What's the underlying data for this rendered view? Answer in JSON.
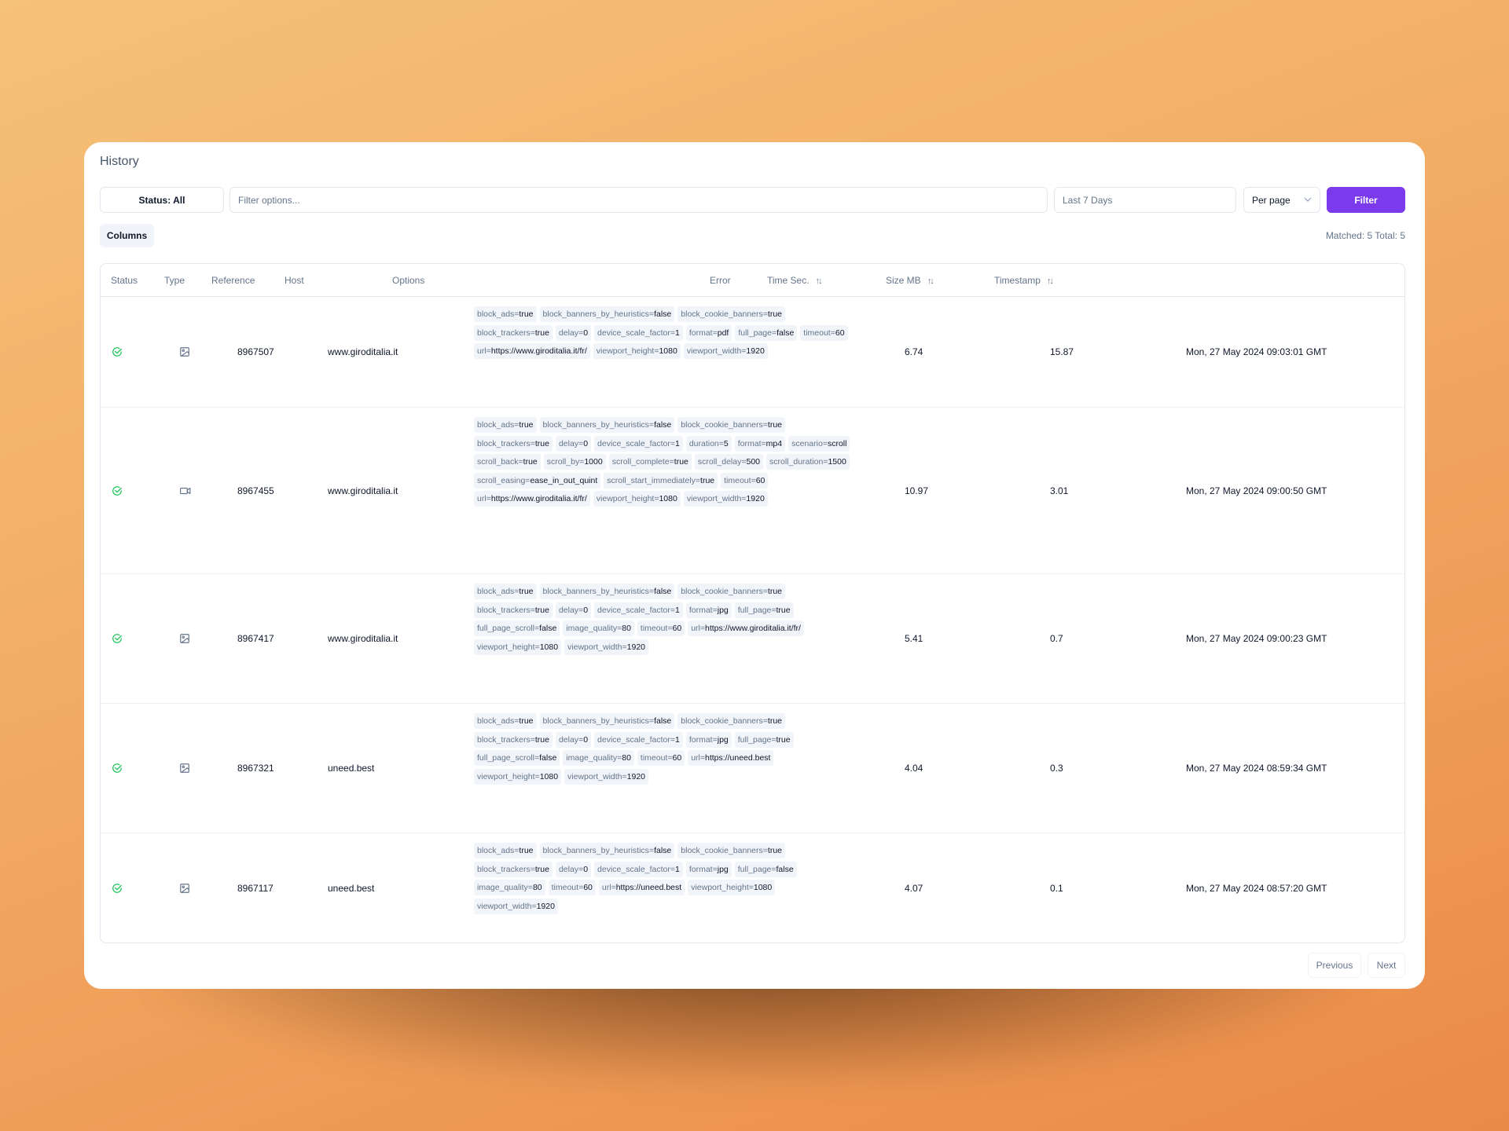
{
  "page": {
    "title": "History",
    "status_filter_label": "Status: All",
    "filter_placeholder": "Filter options...",
    "date_range_placeholder": "Last 7 Days",
    "per_page_label": "Per page",
    "filter_button_label": "Filter",
    "columns_button_label": "Columns",
    "matched_text": "Matched: 5 Total: 5",
    "previous_label": "Previous",
    "next_label": "Next",
    "accent_color": "#7c3aed",
    "success_color": "#22c55e"
  },
  "table": {
    "columns": [
      {
        "label": "Status",
        "sortable": false
      },
      {
        "label": "Type",
        "sortable": false
      },
      {
        "label": "Reference",
        "sortable": false
      },
      {
        "label": "Host",
        "sortable": false
      },
      {
        "label": "Options",
        "sortable": false
      },
      {
        "label": "Error",
        "sortable": false
      },
      {
        "label": "Time Sec.",
        "sortable": true
      },
      {
        "label": "Size MB",
        "sortable": true
      },
      {
        "label": "Timestamp",
        "sortable": true
      }
    ],
    "sort_icon": "arrow-up-down-icon",
    "rows": [
      {
        "status": "success",
        "status_icon": "check-circle-icon",
        "type": "image",
        "type_icon": "image-icon",
        "reference": "8967507",
        "host": "www.giroditalia.it",
        "error": "",
        "time_sec": "6.74",
        "size_mb": "15.87",
        "timestamp": "Mon, 27 May 2024 09:03:01 GMT",
        "options": [
          [
            "block_ads",
            "true"
          ],
          [
            "block_banners_by_heuristics",
            "false"
          ],
          [
            "block_cookie_banners",
            "true"
          ],
          [
            "block_trackers",
            "true"
          ],
          [
            "delay",
            "0"
          ],
          [
            "device_scale_factor",
            "1"
          ],
          [
            "format",
            "pdf"
          ],
          [
            "full_page",
            "false"
          ],
          [
            "timeout",
            "60"
          ],
          [
            "url",
            "https://www.giroditalia.it/fr/"
          ],
          [
            "viewport_height",
            "1080"
          ],
          [
            "viewport_width",
            "1920"
          ]
        ]
      },
      {
        "status": "success",
        "status_icon": "check-circle-icon",
        "type": "video",
        "type_icon": "video-icon",
        "reference": "8967455",
        "host": "www.giroditalia.it",
        "error": "",
        "time_sec": "10.97",
        "size_mb": "3.01",
        "timestamp": "Mon, 27 May 2024 09:00:50 GMT",
        "options": [
          [
            "block_ads",
            "true"
          ],
          [
            "block_banners_by_heuristics",
            "false"
          ],
          [
            "block_cookie_banners",
            "true"
          ],
          [
            "block_trackers",
            "true"
          ],
          [
            "delay",
            "0"
          ],
          [
            "device_scale_factor",
            "1"
          ],
          [
            "duration",
            "5"
          ],
          [
            "format",
            "mp4"
          ],
          [
            "scenario",
            "scroll"
          ],
          [
            "scroll_back",
            "true"
          ],
          [
            "scroll_by",
            "1000"
          ],
          [
            "scroll_complete",
            "true"
          ],
          [
            "scroll_delay",
            "500"
          ],
          [
            "scroll_duration",
            "1500"
          ],
          [
            "scroll_easing",
            "ease_in_out_quint"
          ],
          [
            "scroll_start_immediately",
            "true"
          ],
          [
            "timeout",
            "60"
          ],
          [
            "url",
            "https://www.giroditalia.it/fr/"
          ],
          [
            "viewport_height",
            "1080"
          ],
          [
            "viewport_width",
            "1920"
          ]
        ]
      },
      {
        "status": "success",
        "status_icon": "check-circle-icon",
        "type": "image",
        "type_icon": "image-icon",
        "reference": "8967417",
        "host": "www.giroditalia.it",
        "error": "",
        "time_sec": "5.41",
        "size_mb": "0.7",
        "timestamp": "Mon, 27 May 2024 09:00:23 GMT",
        "options": [
          [
            "block_ads",
            "true"
          ],
          [
            "block_banners_by_heuristics",
            "false"
          ],
          [
            "block_cookie_banners",
            "true"
          ],
          [
            "block_trackers",
            "true"
          ],
          [
            "delay",
            "0"
          ],
          [
            "device_scale_factor",
            "1"
          ],
          [
            "format",
            "jpg"
          ],
          [
            "full_page",
            "true"
          ],
          [
            "full_page_scroll",
            "false"
          ],
          [
            "image_quality",
            "80"
          ],
          [
            "timeout",
            "60"
          ],
          [
            "url",
            "https://www.giroditalia.it/fr/"
          ],
          [
            "viewport_height",
            "1080"
          ],
          [
            "viewport_width",
            "1920"
          ]
        ]
      },
      {
        "status": "success",
        "status_icon": "check-circle-icon",
        "type": "image",
        "type_icon": "image-icon",
        "reference": "8967321",
        "host": "uneed.best",
        "error": "",
        "time_sec": "4.04",
        "size_mb": "0.3",
        "timestamp": "Mon, 27 May 2024 08:59:34 GMT",
        "options": [
          [
            "block_ads",
            "true"
          ],
          [
            "block_banners_by_heuristics",
            "false"
          ],
          [
            "block_cookie_banners",
            "true"
          ],
          [
            "block_trackers",
            "true"
          ],
          [
            "delay",
            "0"
          ],
          [
            "device_scale_factor",
            "1"
          ],
          [
            "format",
            "jpg"
          ],
          [
            "full_page",
            "true"
          ],
          [
            "full_page_scroll",
            "false"
          ],
          [
            "image_quality",
            "80"
          ],
          [
            "timeout",
            "60"
          ],
          [
            "url",
            "https://uneed.best"
          ],
          [
            "viewport_height",
            "1080"
          ],
          [
            "viewport_width",
            "1920"
          ]
        ]
      },
      {
        "status": "success",
        "status_icon": "check-circle-icon",
        "type": "image",
        "type_icon": "image-icon",
        "reference": "8967117",
        "host": "uneed.best",
        "error": "",
        "time_sec": "4.07",
        "size_mb": "0.1",
        "timestamp": "Mon, 27 May 2024 08:57:20 GMT",
        "options": [
          [
            "block_ads",
            "true"
          ],
          [
            "block_banners_by_heuristics",
            "false"
          ],
          [
            "block_cookie_banners",
            "true"
          ],
          [
            "block_trackers",
            "true"
          ],
          [
            "delay",
            "0"
          ],
          [
            "device_scale_factor",
            "1"
          ],
          [
            "format",
            "jpg"
          ],
          [
            "full_page",
            "false"
          ],
          [
            "image_quality",
            "80"
          ],
          [
            "timeout",
            "60"
          ],
          [
            "url",
            "https://uneed.best"
          ],
          [
            "viewport_height",
            "1080"
          ],
          [
            "viewport_width",
            "1920"
          ]
        ]
      }
    ]
  }
}
